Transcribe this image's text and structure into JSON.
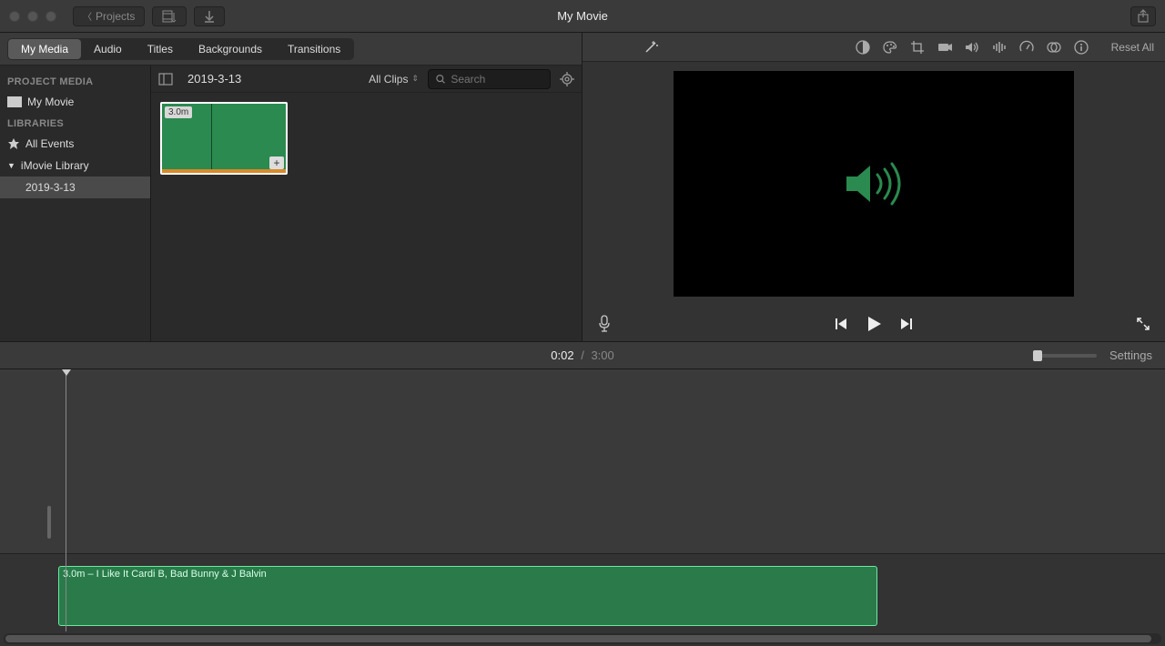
{
  "titlebar": {
    "projects_label": "Projects",
    "title": "My Movie"
  },
  "tabs": {
    "my_media": "My Media",
    "audio": "Audio",
    "titles": "Titles",
    "backgrounds": "Backgrounds",
    "transitions": "Transitions"
  },
  "sidebar": {
    "project_media_header": "PROJECT MEDIA",
    "project_name": "My Movie",
    "libraries_header": "LIBRARIES",
    "all_events": "All Events",
    "imovie_library": "iMovie Library",
    "event_date": "2019-3-13"
  },
  "browser": {
    "header_title": "2019-3-13",
    "filter_label": "All Clips",
    "search_placeholder": "Search",
    "clip_duration": "3.0m"
  },
  "viewer": {
    "reset_all": "Reset All"
  },
  "time": {
    "current": "0:02",
    "separator": "/",
    "total": "3:00",
    "settings": "Settings"
  },
  "timeline": {
    "audio_clip_label": "3.0m – I Like It Cardi B, Bad Bunny & J Balvin"
  }
}
